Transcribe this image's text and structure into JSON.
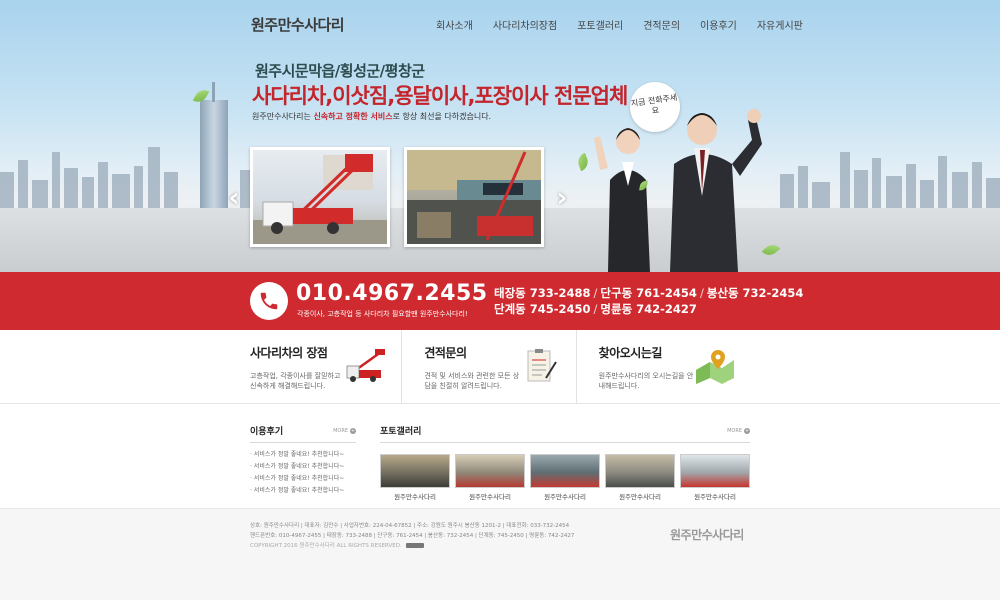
{
  "header": {
    "logo": "원주만수사다리",
    "nav": [
      "회사소개",
      "사다리차의장점",
      "포토갤러리",
      "견적문의",
      "이용후기",
      "자유게시판"
    ]
  },
  "hero": {
    "subtitle": "원주시문막읍/횡성군/평창군",
    "headline": "사다리차,이삿짐,용달이사,포장이사 전문업체",
    "desc_prefix": "원주만수사다리는 ",
    "desc_highlight": "신속하고 정확한 서비스",
    "desc_suffix": "로 항상 최선을 다하겠습니다.",
    "bubble": "지금 전화주세요",
    "prev_arrow": "‹",
    "next_arrow": "›"
  },
  "contact": {
    "phone": "010.4967.2455",
    "note": "각종이사, 고층작업 등 사다리차 필요할땐 원주만수사다리!",
    "branches_row1": [
      "태장동 733-2488",
      "단구동 761-2454",
      "봉산동 732-2454"
    ],
    "branches_row2": [
      "단계동 745-2450",
      "명륜동 742-2427"
    ],
    "separator": "/"
  },
  "features": [
    {
      "title": "사다리차의 장점",
      "desc": "고층작업, 각종이사를 잘믿하고 신속하게 해결해드립니다."
    },
    {
      "title": "견적문의",
      "desc": "견적 및 서비스와 관련한 모든 상담을 친절히 알려드립니다."
    },
    {
      "title": "찾아오시는길",
      "desc": "원주만수사다리의 오시는길을 안내해드립니다."
    }
  ],
  "reviews": {
    "title": "이용후기",
    "more": "MORE",
    "items": [
      "서비스가 정말 좋네요! 추천합니다~",
      "서비스가 정말 좋네요! 추천합니다~",
      "서비스가 정말 좋네요! 추천합니다~",
      "서비스가 정말 좋네요! 추천합니다~"
    ]
  },
  "gallery": {
    "title": "포토갤러리",
    "more": "MORE",
    "items": [
      "원주만수사다리",
      "원주만수사다리",
      "원주만수사다리",
      "원주만수사다리",
      "원주만수사다리"
    ]
  },
  "footer": {
    "line1": "상호: 원주만수사다리 | 대표자: 김만수 | 사업자번호: 224-04-67852 | 주소: 강원도 원주시 봉산동 1201-2 | 대표전화: 033-732-2454",
    "line2": "핸드폰번호: 010-4967-2455 | 태장동: 733-2488 | 단구동: 761-2454 | 봉산동: 732-2454 | 단계동: 745-2450 | 명륜동: 742-2427",
    "copyright": "COPYRIGHT 2016 원주만수사다리 ALL RIGHTS RESERVED.",
    "logo": "원주만수사다리"
  },
  "colors": {
    "brand_red": "#cf2a2f",
    "accent_red": "#c4242b"
  }
}
